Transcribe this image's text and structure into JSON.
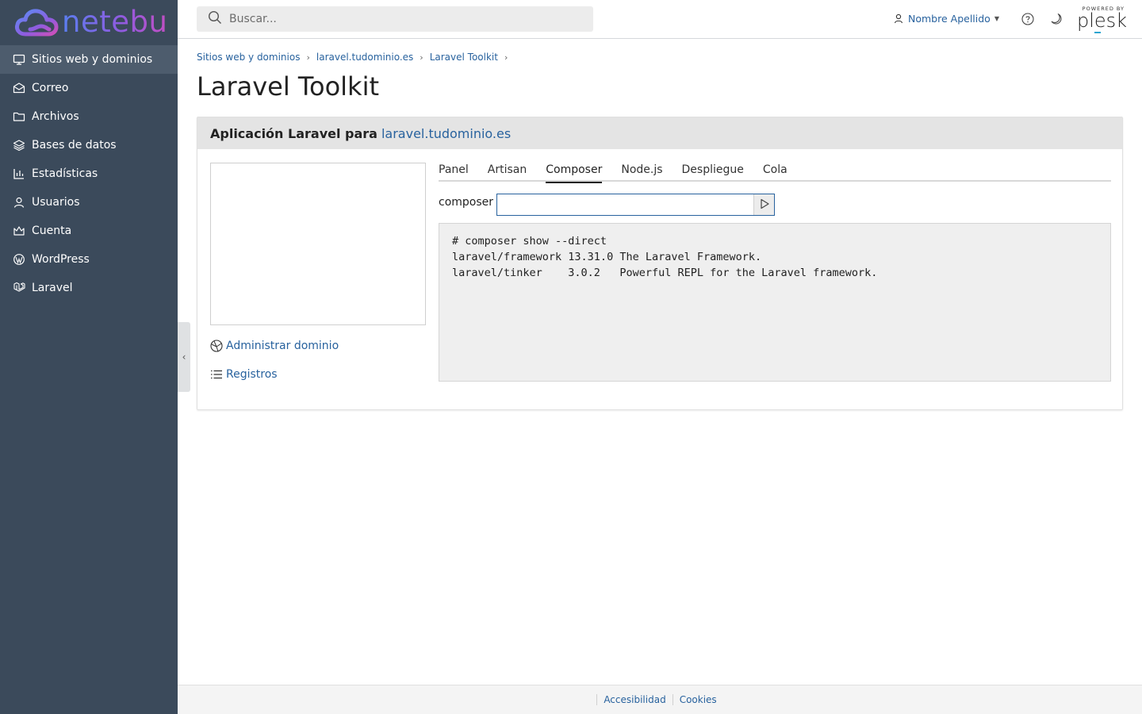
{
  "brand": {
    "name": "netebu"
  },
  "sidebar": {
    "items": [
      {
        "label": "Sitios web y dominios",
        "icon": "monitor-icon",
        "active": true
      },
      {
        "label": "Correo",
        "icon": "mail-icon"
      },
      {
        "label": "Archivos",
        "icon": "folder-icon"
      },
      {
        "label": "Bases de datos",
        "icon": "layers-icon"
      },
      {
        "label": "Estadísticas",
        "icon": "bar-chart-icon"
      },
      {
        "label": "Usuarios",
        "icon": "user-icon"
      },
      {
        "label": "Cuenta",
        "icon": "crown-icon"
      },
      {
        "label": "WordPress",
        "icon": "wordpress-icon"
      },
      {
        "label": "Laravel",
        "icon": "laravel-icon"
      }
    ]
  },
  "header": {
    "search_placeholder": "Buscar...",
    "user_name": "Nombre Apellido",
    "powered_by": "POWERED BY",
    "plesk": "plesk"
  },
  "breadcrumb": [
    "Sitios web y dominios",
    "laravel.tudominio.es",
    "Laravel Toolkit"
  ],
  "page": {
    "title": "Laravel Toolkit"
  },
  "panel": {
    "heading_prefix": "Aplicación Laravel para",
    "heading_domain": "laravel.tudominio.es",
    "links": {
      "manage_domain": "Administrar dominio",
      "logs": "Registros"
    },
    "tabs": [
      "Panel",
      "Artisan",
      "Composer",
      "Node.js",
      "Despliegue",
      "Cola"
    ],
    "active_tab": "Composer",
    "command_label": "composer",
    "command_value": "",
    "output_lines": [
      "# composer show --direct",
      "laravel/framework 13.31.0 The Laravel Framework.",
      "laravel/tinker    3.0.2   Powerful REPL for the Laravel framework."
    ]
  },
  "footer": {
    "links": [
      "Accesibilidad",
      "Cookies"
    ]
  },
  "colors": {
    "sidebar": "#3b4a5b",
    "link": "#28629e",
    "panel_head": "#e4e4e4"
  }
}
